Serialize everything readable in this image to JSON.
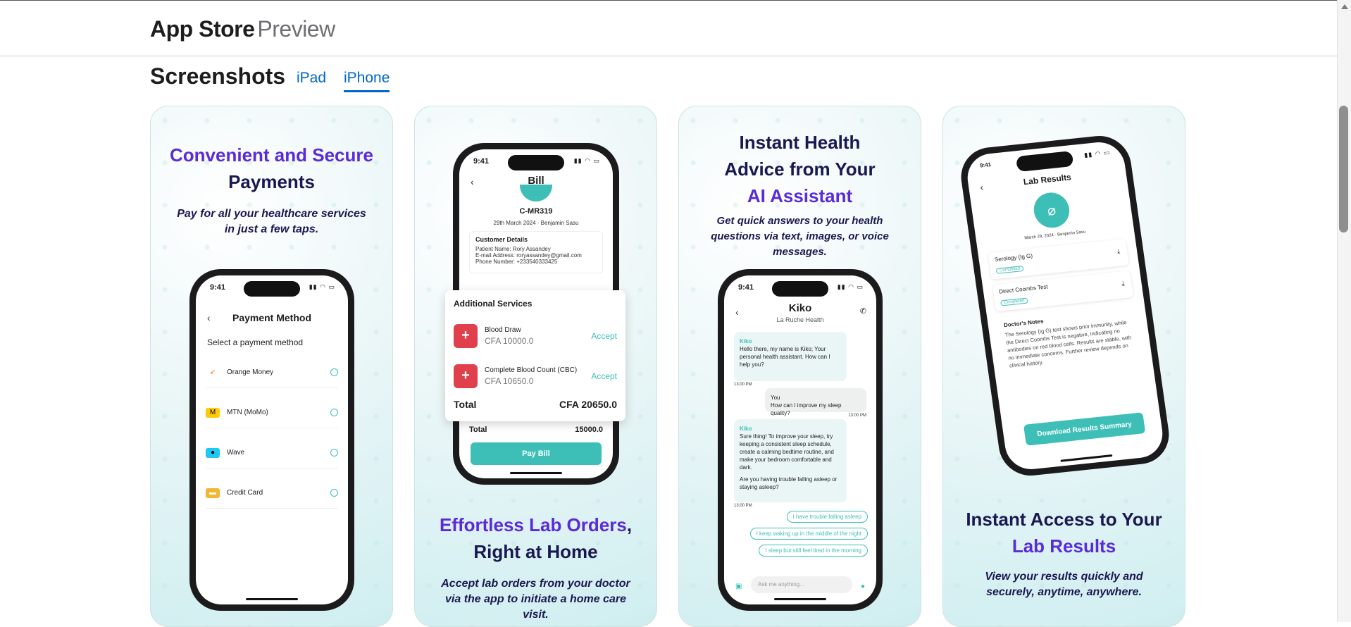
{
  "header": {
    "brand": "App Store",
    "brand_sub": "Preview"
  },
  "screenshots": {
    "title": "Screenshots",
    "tabs": [
      {
        "label": "iPad"
      },
      {
        "label": "iPhone"
      }
    ],
    "selected_tab": "iPhone"
  },
  "cards": [
    {
      "headline_accent": "Convenient and Secure",
      "headline_rest": "Payments",
      "subtitle": "Pay for all your healthcare services in just a few taps.",
      "phone": {
        "time": "9:41",
        "title": "Payment Method",
        "prompt": "Select a payment method",
        "methods": [
          {
            "name": "Orange Money",
            "icon": "orange-money-icon"
          },
          {
            "name": "MTN (MoMo)",
            "icon": "mtn-momo-icon"
          },
          {
            "name": "Wave",
            "icon": "wave-icon"
          },
          {
            "name": "Credit Card",
            "icon": "credit-card-icon"
          }
        ]
      }
    },
    {
      "headline_accent": "Effortless Lab Orders",
      "headline_comma": ",",
      "headline_rest": "Right at Home",
      "subtitle": "Accept lab orders from your doctor via the app to initiate a home care visit.",
      "phone": {
        "time": "9:41",
        "title": "Bill",
        "bill_id": "C-MR319",
        "date": "29th March 2024",
        "person": "Benjamin Sasu",
        "customer_heading": "Customer Details",
        "patient": "Patient Name: Rory Assandey",
        "email": "E-mail Address: roryassandey@gmail.com",
        "phone": "Phone Number: +233540333425",
        "total_label": "Total",
        "total_value": "15000.0",
        "pay_button": "Pay Bill"
      },
      "overlay": {
        "heading": "Additional Services",
        "items": [
          {
            "name": "Blood Draw",
            "price": "CFA 10000.0",
            "action": "Accept"
          },
          {
            "name": "Complete Blood Count (CBC)",
            "price": "CFA 10650.0",
            "action": "Accept"
          }
        ],
        "total_label": "Total",
        "total_value": "CFA 20650.0"
      }
    },
    {
      "headline_line1": "Instant Health",
      "headline_line2": "Advice from Your",
      "headline_accent": "AI Assistant",
      "subtitle": "Get quick answers to your health questions via text, images, or voice messages.",
      "phone": {
        "time": "9:41",
        "name": "Kiko",
        "org": "La Ruche Health",
        "msg1_sender": "Kiko",
        "msg1": "Hello there, my name is Kiko; Your personal health assistant. How can I help you?",
        "t1": "13:00 PM",
        "user_sender": "You",
        "user_msg": "How can I improve my sleep quality?",
        "t2": "13:00 PM",
        "msg2_sender": "Kiko",
        "msg2": "Sure thing! To improve your sleep, try keeping a consistent sleep schedule, create a calming bedtime routine, and make your bedroom comfortable and dark.",
        "msg2b": "Are you having trouble falling asleep or staying asleep?",
        "t3": "13:00 PM",
        "chips": [
          "I have trouble falling asleep",
          "I keep waking up in the middle of the night",
          "I sleep but still feel tired in the morning"
        ],
        "input_placeholder": "Ask me anything..."
      }
    },
    {
      "headline_rest": "Instant Access to Your",
      "headline_accent": "Lab Results",
      "subtitle": "View your results quickly and securely, anytime, anywhere.",
      "phone": {
        "time": "9:41",
        "title": "Lab Results",
        "date": "March 29, 2024",
        "person": "Benjamin Sasu",
        "tests": [
          {
            "name": "Serology (Ig G)",
            "status": "Completed"
          },
          {
            "name": "Direct Coombs Test",
            "status": "Completed"
          }
        ],
        "notes_heading": "Doctor's Notes",
        "notes": "The Serology (Ig G) test shows prior immunity, while the Direct Coombs Test is negative, indicating no antibodies on red blood cells. Results are stable, with no immediate concerns. Further review depends on clinical history.",
        "download_button": "Download Results Summary"
      }
    }
  ]
}
